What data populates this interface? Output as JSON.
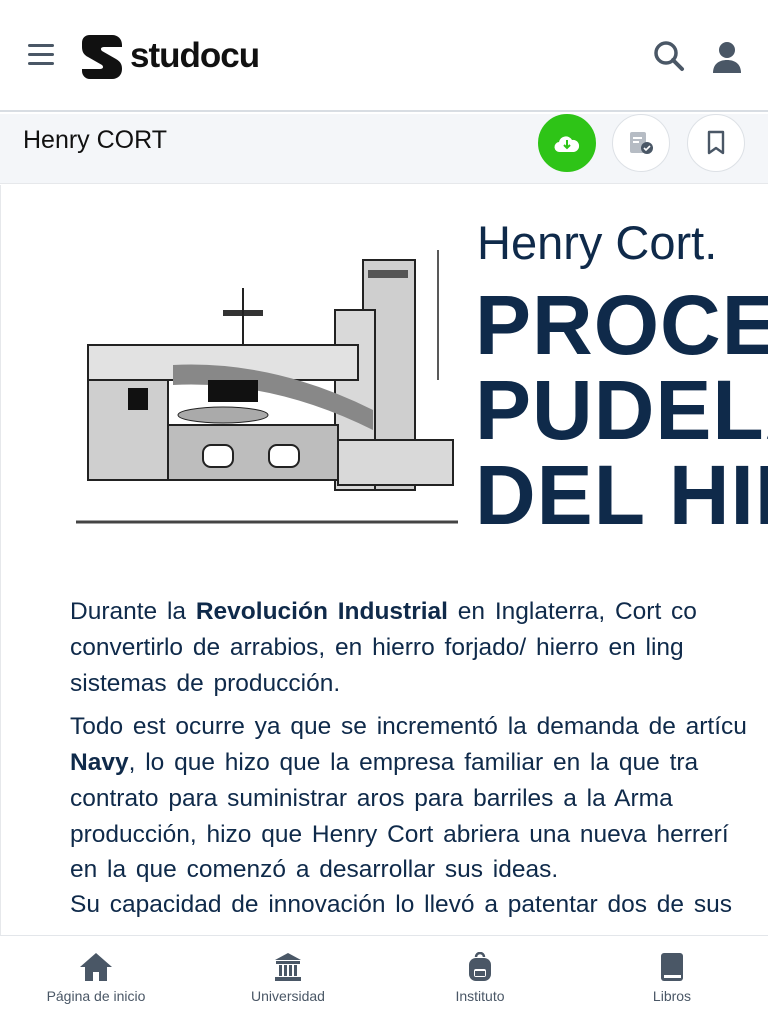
{
  "header": {
    "brand": "studocu",
    "icons": [
      "menu-icon",
      "search-icon",
      "user-icon"
    ]
  },
  "doc_bar": {
    "title": "Henry CORT",
    "icons": [
      "cloud-download-icon",
      "document-check-icon",
      "bookmark-icon"
    ],
    "download_color": "#2ec417"
  },
  "document": {
    "subtitle": "Henry Cort.",
    "title_lines": [
      "PROCES",
      "PUDELAC",
      "DEL HIER"
    ],
    "p1": [
      {
        "pre": "Durante la ",
        "bold": "Revolución Industrial",
        "post": " en Inglaterra, Cort co"
      },
      {
        "pre": "convertirlo de arrabios, en hierro forjado/ hierro en ling"
      },
      {
        "pre": "sistemas de producción."
      }
    ],
    "p2": [
      {
        "pre": "Todo est ocurre ya que se incrementó la demanda de artícu"
      },
      {
        "bold": "Navy",
        "post": ", lo que hizo que la empresa familiar en la que tra"
      },
      {
        "pre": "contrato para suministrar aros para barriles a la Arma"
      },
      {
        "pre": "producción, hizo que Henry Cort abriera una nueva herrerí"
      },
      {
        "pre": "en la que comenzó a desarrollar sus ideas."
      },
      {
        "pre": "Su capacidad de innovación lo llevó a patentar dos de sus"
      }
    ],
    "text_color": "#0f2a4a"
  },
  "bottom_nav": [
    {
      "label": "Página de inicio",
      "icon": "home-icon"
    },
    {
      "label": "Universidad",
      "icon": "university-icon"
    },
    {
      "label": "Instituto",
      "icon": "backpack-icon"
    },
    {
      "label": "Libros",
      "icon": "book-icon"
    }
  ]
}
